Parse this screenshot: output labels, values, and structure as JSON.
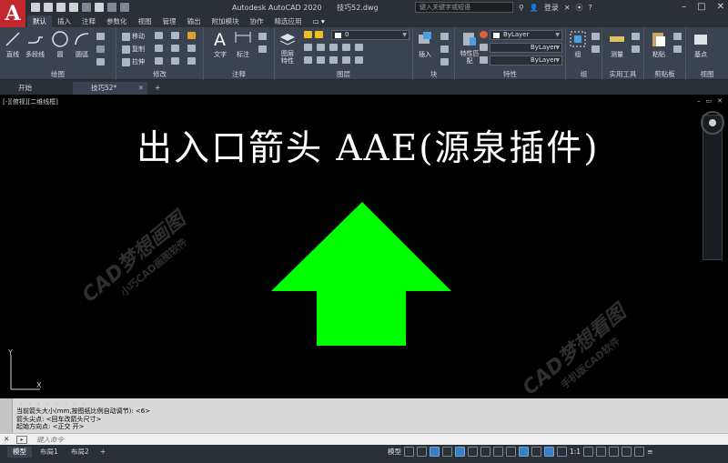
{
  "app": {
    "logo_letter": "A",
    "title": "Autodesk AutoCAD 2020",
    "filename": "技巧52.dwg",
    "search_placeholder": "键入关键字或短语",
    "login_label": "登录"
  },
  "ribbon_tabs": [
    "默认",
    "插入",
    "注释",
    "参数化",
    "视图",
    "管理",
    "输出",
    "附加模块",
    "协作",
    "精选应用"
  ],
  "panels": {
    "draw": {
      "label": "绘图",
      "tools": [
        "直线",
        "多段线",
        "圆",
        "圆弧"
      ]
    },
    "modify": {
      "label": "修改",
      "tools": [
        "移动",
        "复制",
        "拉伸"
      ]
    },
    "annotation": {
      "label": "注释",
      "tools": [
        "文字",
        "标注"
      ]
    },
    "layers": {
      "label": "图层",
      "tool": "图层特性",
      "current_layer": "0"
    },
    "block": {
      "label": "块",
      "tool": "插入"
    },
    "properties": {
      "label": "特性",
      "tool": "特性匹配",
      "color": "ByLayer",
      "linetype": "ByLayer",
      "lineweight": "ByLayer"
    },
    "groups": {
      "label": "组",
      "tool": "组"
    },
    "utilities": {
      "label": "实用工具",
      "tool": "测量"
    },
    "clipboard": {
      "label": "剪贴板",
      "tool": "粘贴"
    },
    "view": {
      "label": "视图",
      "tool": "基点"
    }
  },
  "doc_tabs": [
    "开始",
    "技巧52*"
  ],
  "viewport": {
    "label": "[-][俯视][二维线框]",
    "title_text": "出入口箭头  AAE(源泉插件)",
    "arrow_color": "#00ff00",
    "ucs_y": "Y",
    "ucs_x": "X"
  },
  "watermarks": [
    {
      "big": "CAD梦想画图",
      "small": "小巧CAD画图软件"
    },
    {
      "big": "CAD梦想看图",
      "small": "手机版CAD软件"
    }
  ],
  "command": {
    "history_dots": ". . . . . . . .",
    "lines": [
      "当前箭头大小(mm,按图纸比例自动调节): <6>",
      "箭头尖点: <回车改箭头尺寸>",
      "起始方向点: <正交 开>"
    ],
    "placeholder": "键入命令"
  },
  "layout_tabs": [
    "模型",
    "布局1",
    "布局2"
  ],
  "status": {
    "model_label": "模型",
    "scale": "1:1"
  }
}
